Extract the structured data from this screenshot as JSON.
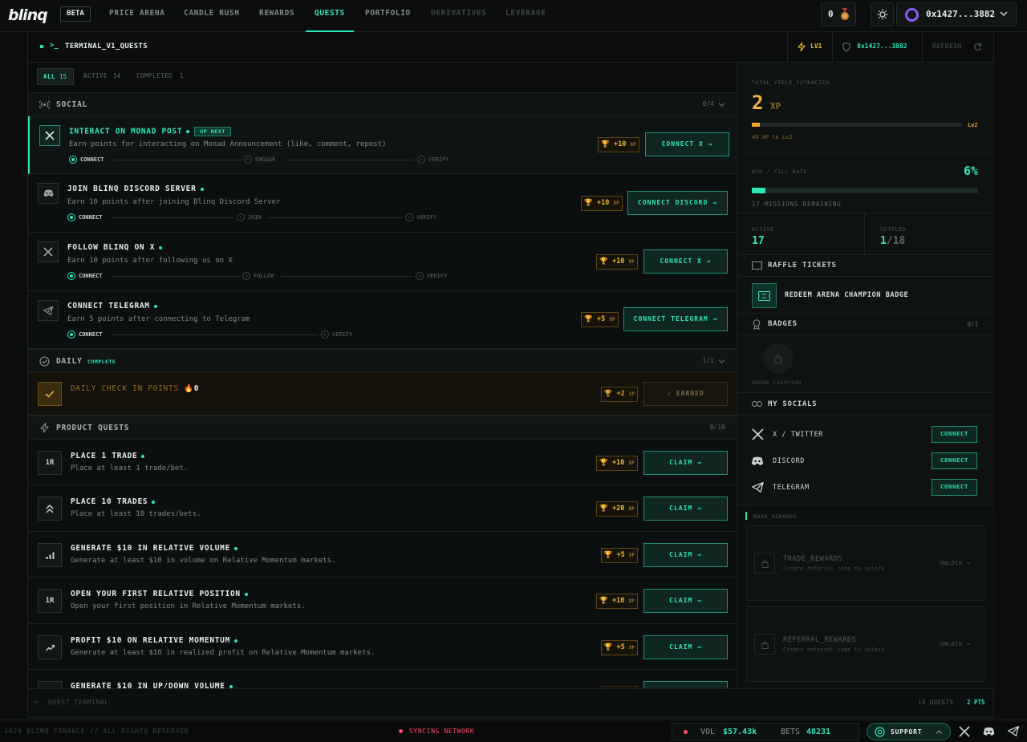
{
  "nav": {
    "logo": "blinq",
    "beta": "BETA",
    "items": [
      {
        "label": "PRICE ARENA",
        "state": "normal"
      },
      {
        "label": "CANDLE RUSH",
        "state": "normal"
      },
      {
        "label": "REWARDS",
        "state": "normal"
      },
      {
        "label": "QUESTS",
        "state": "active"
      },
      {
        "label": "PORTFOLIO",
        "state": "normal"
      },
      {
        "label": "DERIVATIVES",
        "state": "disabled"
      },
      {
        "label": "LEVERAGE",
        "state": "disabled"
      }
    ],
    "points": "0",
    "wallet": "0x1427...3882"
  },
  "header": {
    "prompt": ">_",
    "title": "TERMINAL_V1_QUESTS",
    "level": "LV1",
    "address": "0x1427...3882",
    "refresh": "REFRESH"
  },
  "filters": {
    "all_label": "ALL",
    "all_count": "15",
    "active_label": "ACTIVE",
    "active_count": "14",
    "completed_label": "COMPLETED",
    "completed_count": "1"
  },
  "social": {
    "title": "SOCIAL",
    "count": "0/4",
    "quests": [
      {
        "title": "INTERACT ON MONAD POST",
        "badge": "UP NEXT",
        "desc": "Earn points for interacting on Monad Announcement (like, comment, repost)",
        "steps": [
          "CONNECT",
          "ENGAGE",
          "VERIFY"
        ],
        "xp": "+10",
        "xp_unit": "XP",
        "button": "CONNECT X"
      },
      {
        "title": "JOIN BLINQ DISCORD SERVER",
        "desc": "Earn 10 points after joining Blinq Discord Server",
        "steps": [
          "CONNECT",
          "JOIN",
          "VERIFY"
        ],
        "xp": "+10",
        "xp_unit": "XP",
        "button": "CONNECT DISCORD"
      },
      {
        "title": "FOLLOW BLINQ ON X",
        "desc": "Earn 10 points after following us on X",
        "steps": [
          "CONNECT",
          "FOLLOW",
          "VERIFY"
        ],
        "xp": "+10",
        "xp_unit": "XP",
        "button": "CONNECT X"
      },
      {
        "title": "CONNECT TELEGRAM",
        "desc": "Earn 5 points after connecting to Telegram",
        "steps": [
          "CONNECT",
          "VERIFY"
        ],
        "xp": "+5",
        "xp_unit": "XP",
        "button": "CONNECT TELEGRAM"
      }
    ]
  },
  "daily": {
    "title": "DAILY",
    "status": "COMPLETE",
    "count": "1/1",
    "quest": {
      "title": "DAILY CHECK IN POINTS",
      "streak": "0",
      "xp": "+2",
      "xp_unit": "XP",
      "button": "EARNED"
    }
  },
  "product": {
    "title": "PRODUCT QUESTS",
    "count": "0/10",
    "quests": [
      {
        "icon": "1R",
        "title": "PLACE 1 TRADE",
        "desc": "Place at least 1 trade/bet.",
        "xp": "+10",
        "xp_unit": "XP",
        "button": "CLAIM"
      },
      {
        "icon": "chevrons-up",
        "title": "PLACE 10 TRADES",
        "desc": "Place at least 10 trades/bets.",
        "xp": "+20",
        "xp_unit": "XP",
        "button": "CLAIM"
      },
      {
        "icon": "bars",
        "title": "GENERATE $10 IN RELATIVE VOLUME",
        "desc": "Generate at least $10 in volume on Relative Momentum markets.",
        "xp": "+5",
        "xp_unit": "XP",
        "button": "CLAIM"
      },
      {
        "icon": "1R",
        "title": "OPEN YOUR FIRST RELATIVE POSITION",
        "desc": "Open your first position in Relative Momentum markets.",
        "xp": "+10",
        "xp_unit": "XP",
        "button": "CLAIM"
      },
      {
        "icon": "trend-up",
        "title": "PROFIT $10 ON RELATIVE MOMENTUM",
        "desc": "Generate at least $10 in realized profit on Relative Momentum markets.",
        "xp": "+5",
        "xp_unit": "XP",
        "button": "CLAIM"
      },
      {
        "icon": "bars",
        "title": "GENERATE $10 IN UP/DOWN VOLUME",
        "desc": "",
        "xp": "",
        "xp_unit": "",
        "button": ""
      }
    ]
  },
  "stats": {
    "yield_label": "TOTAL_YIELD_EXTRACTED",
    "xp_value": "2",
    "xp_unit": "XP",
    "xp_progress": 0.04,
    "next_level": "Lv2",
    "to_next": "48 XP to Lv2",
    "win_label": "WIN / FILL RATE",
    "win_rate": "6%",
    "win_progress": 0.06,
    "missions_remaining": "17 MISSIONS REMAINING",
    "active_label": "ACTIVE",
    "active_value": "17",
    "settled_label": "SETTLED",
    "settled_value": "1",
    "settled_total": "/18"
  },
  "raffle": {
    "title": "RAFFLE TICKETS",
    "item": "REDEEM ARENA CHAMPION BADGE"
  },
  "badges": {
    "title": "BADGES",
    "count": "0/1",
    "badge_name": "ARENA CHAMPION"
  },
  "socials": {
    "title": "MY SOCIALS",
    "items": [
      {
        "label": "X / TWITTER",
        "button": "CONNECT"
      },
      {
        "label": "DISCORD",
        "button": "CONNECT"
      },
      {
        "label": "TELEGRAM",
        "button": "CONNECT"
      }
    ]
  },
  "base_rewards": {
    "title": "BASE_REWARDS",
    "cards": [
      {
        "title": "TRADE_REWARDS",
        "desc": "Create referral code to unlock",
        "action": "UNLOCK"
      },
      {
        "title": "REFERRAL_REWARDS",
        "desc": "Create referral code to unlock",
        "action": "UNLOCK"
      }
    ]
  },
  "footer": {
    "terminal": "QUEST_TERMINAL",
    "quests": "18 QUESTS",
    "pts": "2 PTS",
    "copyright": "© 2026 BLINQ FINANCE // ALL RIGHTS RESERVED",
    "syncing": "SYNCING NETWORK",
    "vol_label": "VOL",
    "vol_value": "$57.43k",
    "bets_label": "BETS",
    "bets_value": "48231",
    "support": "SUPPORT"
  },
  "colors": {
    "accent": "#2ee6b8",
    "xp": "#f0b43a",
    "background": "#0b0d0d",
    "alert": "#ff4d6a"
  }
}
